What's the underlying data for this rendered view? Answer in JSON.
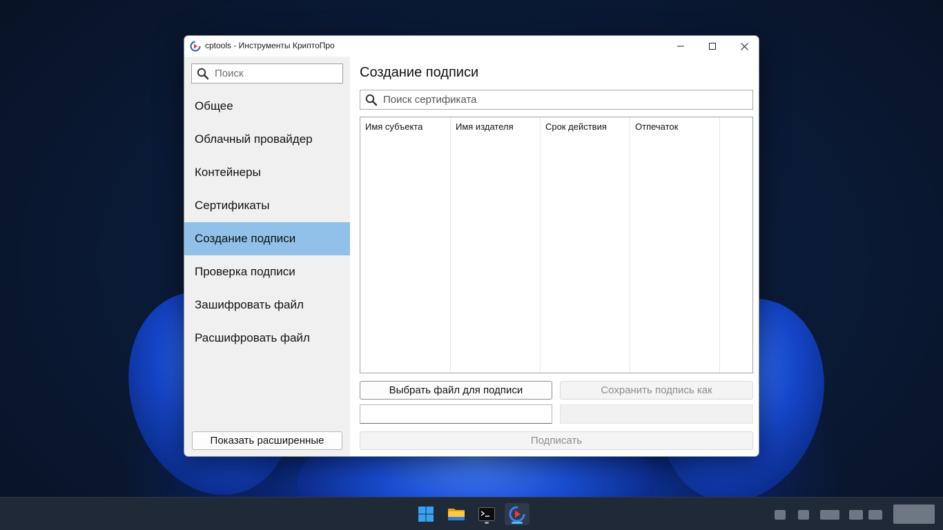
{
  "window": {
    "title": "cptools - Инструменты КриптоПро"
  },
  "sidebar": {
    "search_placeholder": "Поиск",
    "items": [
      {
        "label": "Общее"
      },
      {
        "label": "Облачный провайдер"
      },
      {
        "label": "Контейнеры"
      },
      {
        "label": "Сертификаты"
      },
      {
        "label": "Создание подписи",
        "active": true
      },
      {
        "label": "Проверка подписи"
      },
      {
        "label": "Зашифровать файл"
      },
      {
        "label": "Расшифровать файл"
      }
    ],
    "advanced_button": "Показать расширенные"
  },
  "main": {
    "title": "Создание подписи",
    "cert_search_placeholder": "Поиск сертификата",
    "table": {
      "columns": [
        "Имя субъекта",
        "Имя издателя",
        "Срок действия",
        "Отпечаток"
      ],
      "rows": []
    },
    "choose_file_button": "Выбрать файл для подписи",
    "save_signature_button": "Сохранить подпись как",
    "file_path_value": "",
    "save_path_value": "",
    "sign_button": "Подписать"
  },
  "taskbar": {
    "icons": [
      "windows-start-icon",
      "file-explorer-icon",
      "terminal-icon",
      "cptools-app-icon"
    ],
    "active": "cptools-app-icon"
  },
  "colors": {
    "selection": "#91c1e8",
    "sidebar_bg": "#f0f0f0",
    "taskbar_bg": "#1f2937",
    "accent_blue": "#4cc2ff"
  }
}
